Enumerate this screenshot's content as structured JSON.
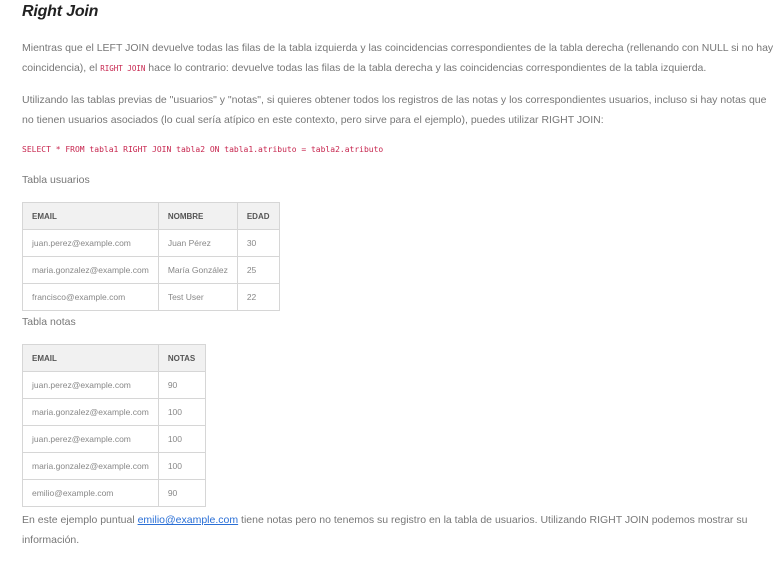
{
  "heading": "Right Join",
  "p1": {
    "before": "Mientras que el LEFT JOIN devuelve todas las filas de la tabla izquierda y las coincidencias correspondientes de la tabla derecha (rellenando con NULL si no hay coincidencia), el ",
    "code": "RIGHT JOIN",
    "after": " hace lo contrario: devuelve todas las filas de la tabla derecha y las coincidencias correspondientes de la tabla izquierda."
  },
  "p2": "Utilizando las tablas previas de \"usuarios\" y \"notas\", si quieres obtener todos los registros de las notas y los correspondientes usuarios, incluso si hay notas que no tienen usuarios asociados (lo cual sería atípico en este contexto, pero sirve para el ejemplo), puedes utilizar RIGHT JOIN:",
  "code_line": "SELECT * FROM tabla1 RIGHT JOIN tabla2 ON tabla1.atributo = tabla2.atributo",
  "caption_usuarios": "Tabla usuarios",
  "usuarios": {
    "headers": [
      "EMAIL",
      "NOMBRE",
      "EDAD"
    ],
    "rows": [
      [
        "juan.perez@example.com",
        "Juan Pérez",
        "30"
      ],
      [
        "maria.gonzalez@example.com",
        "María González",
        "25"
      ],
      [
        "francisco@example.com",
        "Test User",
        "22"
      ]
    ]
  },
  "caption_notas": "Tabla notas",
  "notas": {
    "headers": [
      "EMAIL",
      "NOTAS"
    ],
    "rows": [
      [
        "juan.perez@example.com",
        "90"
      ],
      [
        "maria.gonzalez@example.com",
        "100"
      ],
      [
        "juan.perez@example.com",
        "100"
      ],
      [
        "maria.gonzalez@example.com",
        "100"
      ],
      [
        "emilio@example.com",
        "90"
      ]
    ]
  },
  "p3": {
    "before": "En este ejemplo puntual ",
    "link": "emilio@example.com",
    "after": " tiene notas pero no tenemos su registro en la tabla de usuarios. Utilizando RIGHT JOIN podemos mostrar su información."
  },
  "colors": {
    "code": "#c7254e",
    "link": "#2a6fd6",
    "header_bg": "#f1f1f1",
    "border": "#d6d6d6"
  }
}
